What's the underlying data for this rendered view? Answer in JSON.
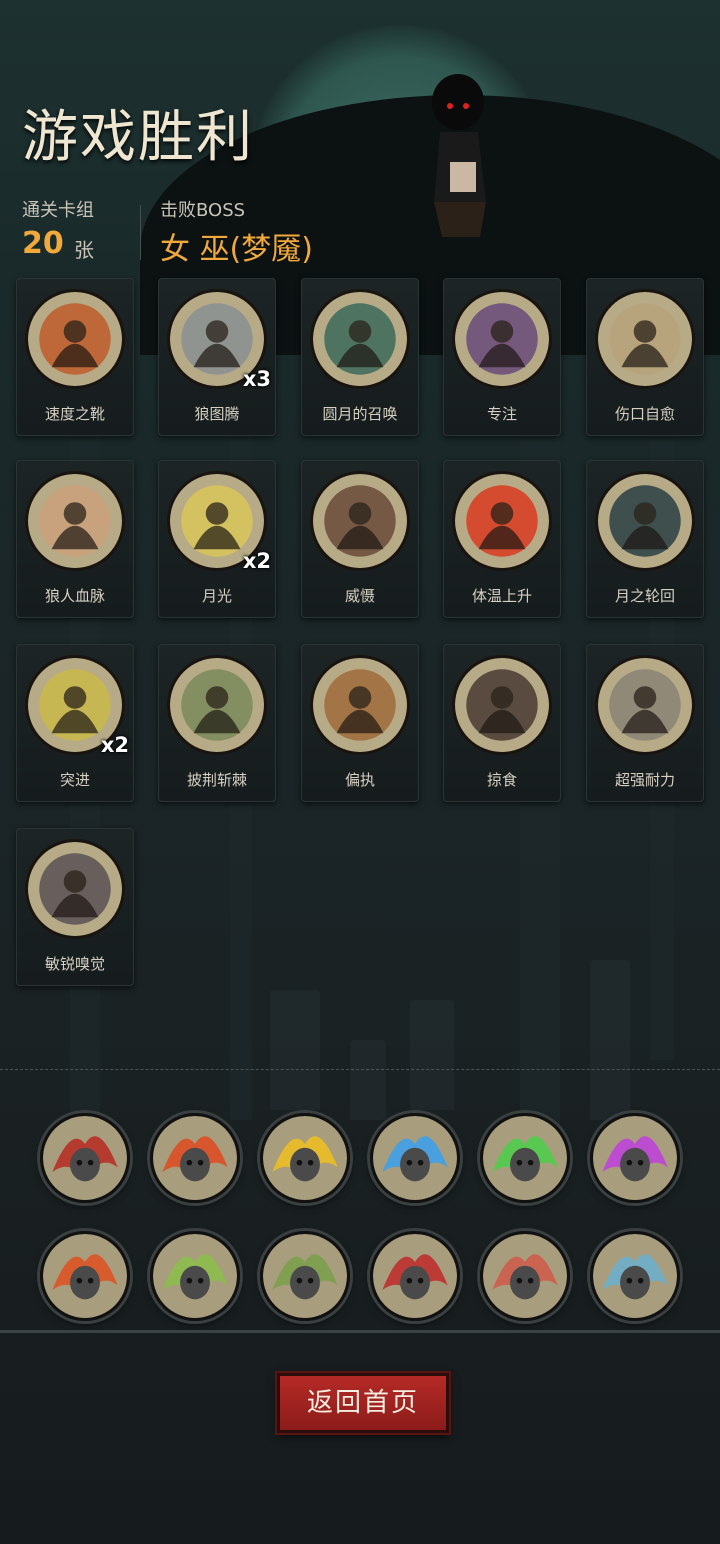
{
  "header": {
    "title": "游戏胜利",
    "deck_label": "通关卡组",
    "deck_count": "20",
    "deck_unit": "张",
    "boss_label": "击败BOSS",
    "boss_name": "女 巫(梦魇)"
  },
  "cards": [
    {
      "label": "速度之靴",
      "count": "",
      "icon": "boot-icon",
      "color": "#c05a2a"
    },
    {
      "label": "狼图腾",
      "count": "x3",
      "icon": "wolf-totem-icon",
      "color": "#8a8f92"
    },
    {
      "label": "圆月的召唤",
      "count": "",
      "icon": "full-moon-forest-icon",
      "color": "#3c6a5a"
    },
    {
      "label": "专注",
      "count": "",
      "icon": "wizard-icon",
      "color": "#6a4a7a"
    },
    {
      "label": "伤口自愈",
      "count": "",
      "icon": "healing-boy-icon",
      "color": "#b8a27a"
    },
    {
      "label": "狼人血脉",
      "count": "",
      "icon": "werewolf-hand-icon",
      "color": "#caa07a"
    },
    {
      "label": "月光",
      "count": "x2",
      "icon": "yellow-moon-icon",
      "color": "#d9c55a"
    },
    {
      "label": "威慑",
      "count": "",
      "icon": "bear-icon",
      "color": "#6a4a3a"
    },
    {
      "label": "体温上升",
      "count": "",
      "icon": "fire-wolf-icon",
      "color": "#d93a20"
    },
    {
      "label": "月之轮回",
      "count": "",
      "icon": "moon-phases-icon",
      "color": "#2a3e44"
    },
    {
      "label": "突进",
      "count": "x2",
      "icon": "dash-wolf-icon",
      "color": "#c9b84a"
    },
    {
      "label": "披荆斩棘",
      "count": "",
      "icon": "axe-icon",
      "color": "#7a8a5a"
    },
    {
      "label": "偏执",
      "count": "",
      "icon": "angry-wolf-icon",
      "color": "#a06a3a"
    },
    {
      "label": "掠食",
      "count": "",
      "icon": "shadow-wolf-icon",
      "color": "#4a3a34"
    },
    {
      "label": "超强耐力",
      "count": "",
      "icon": "runner-icon",
      "color": "#8a8276"
    },
    {
      "label": "敏锐嗅觉",
      "count": "",
      "icon": "snarling-wolf-icon",
      "color": "#5a5054"
    }
  ],
  "relics": [
    {
      "icon": "werewolf-relic-icon",
      "color": "#b82a22"
    },
    {
      "icon": "skull-red-flame-icon",
      "color": "#e04a20"
    },
    {
      "icon": "skull-yellow-flame-icon",
      "color": "#f0c020"
    },
    {
      "icon": "skull-blue-flame-icon",
      "color": "#3aa0f0"
    },
    {
      "icon": "skull-green-flame-icon",
      "color": "#4ad04a"
    },
    {
      "icon": "skull-purple-flame-icon",
      "color": "#c040e0"
    },
    {
      "icon": "burning-altar-icon",
      "color": "#e05020"
    },
    {
      "icon": "poison-hand-icon",
      "color": "#8ac04a"
    },
    {
      "icon": "ghost-ogre-icon",
      "color": "#7aa04a"
    },
    {
      "icon": "red-book-icon",
      "color": "#c02a2a"
    },
    {
      "icon": "blood-drops-icon",
      "color": "#d05a4a"
    },
    {
      "icon": "card-hand-icon",
      "color": "#6ab0d0"
    }
  ],
  "footer": {
    "home_label": "返回首页"
  }
}
